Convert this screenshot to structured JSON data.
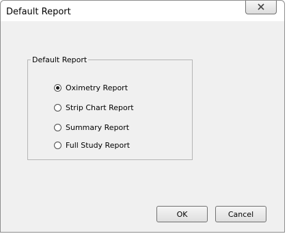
{
  "window": {
    "title": "Default Report"
  },
  "group": {
    "legend": "Default Report",
    "options": [
      {
        "label": "Oximetry Report",
        "selected": true
      },
      {
        "label": "Strip Chart Report",
        "selected": false
      },
      {
        "label": "Summary Report",
        "selected": false
      },
      {
        "label": "Full Study Report",
        "selected": false
      }
    ]
  },
  "buttons": {
    "ok_label": "OK",
    "cancel_label": "Cancel"
  },
  "icons": {
    "close": "close-icon"
  },
  "colors": {
    "dialog_background": "#f0f0f0",
    "border": "#8c8c8c"
  }
}
